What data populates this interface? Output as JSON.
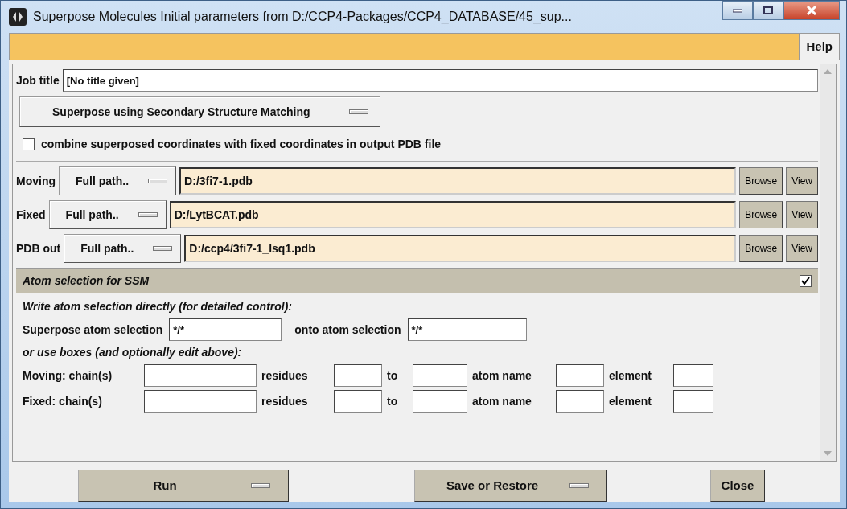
{
  "window": {
    "title": "Superpose Molecules Initial parameters from D:/CCP4-Packages/CCP4_DATABASE/45_sup..."
  },
  "menu_bar": {
    "help": "Help"
  },
  "job_title": {
    "label": "Job title",
    "value": "[No title given]"
  },
  "mode_menu": {
    "label": "Superpose using Secondary Structure Matching"
  },
  "combine": {
    "label": "combine superposed coordinates with fixed coordinates in output PDB file",
    "checked": false
  },
  "files": [
    {
      "label": "Moving",
      "menu": "Full path..",
      "value": "D:/3fi7-1.pdb",
      "browse": "Browse",
      "view": "View"
    },
    {
      "label": "Fixed",
      "menu": "Full path..",
      "value": "D:/LytBCAT.pdb",
      "browse": "Browse",
      "view": "View"
    },
    {
      "label": "PDB out",
      "menu": "Full path..",
      "value": "D:/ccp4/3fi7-1_lsq1.pdb",
      "browse": "Browse",
      "view": "View"
    }
  ],
  "atom_section": {
    "title": "Atom selection for SSM",
    "expanded": true,
    "direct_heading": "Write atom selection directly (for detailed control):",
    "superpose_label": "Superpose atom selection",
    "superpose_value": "*/*",
    "onto_label": "onto atom selection",
    "onto_value": "*/*",
    "boxes_heading": "or use boxes (and optionally edit above):",
    "rows": [
      {
        "label": "Moving: chain(s)",
        "residues": "residues",
        "to": "to",
        "atom_name": "atom name",
        "element": "element"
      },
      {
        "label": "Fixed: chain(s)",
        "residues": "residues",
        "to": "to",
        "atom_name": "atom name",
        "element": "element"
      }
    ]
  },
  "buttons": [
    {
      "label": "Run",
      "kind": "menu"
    },
    {
      "label": "Save or Restore",
      "kind": "menu"
    },
    {
      "label": "Close",
      "kind": "plain"
    }
  ]
}
